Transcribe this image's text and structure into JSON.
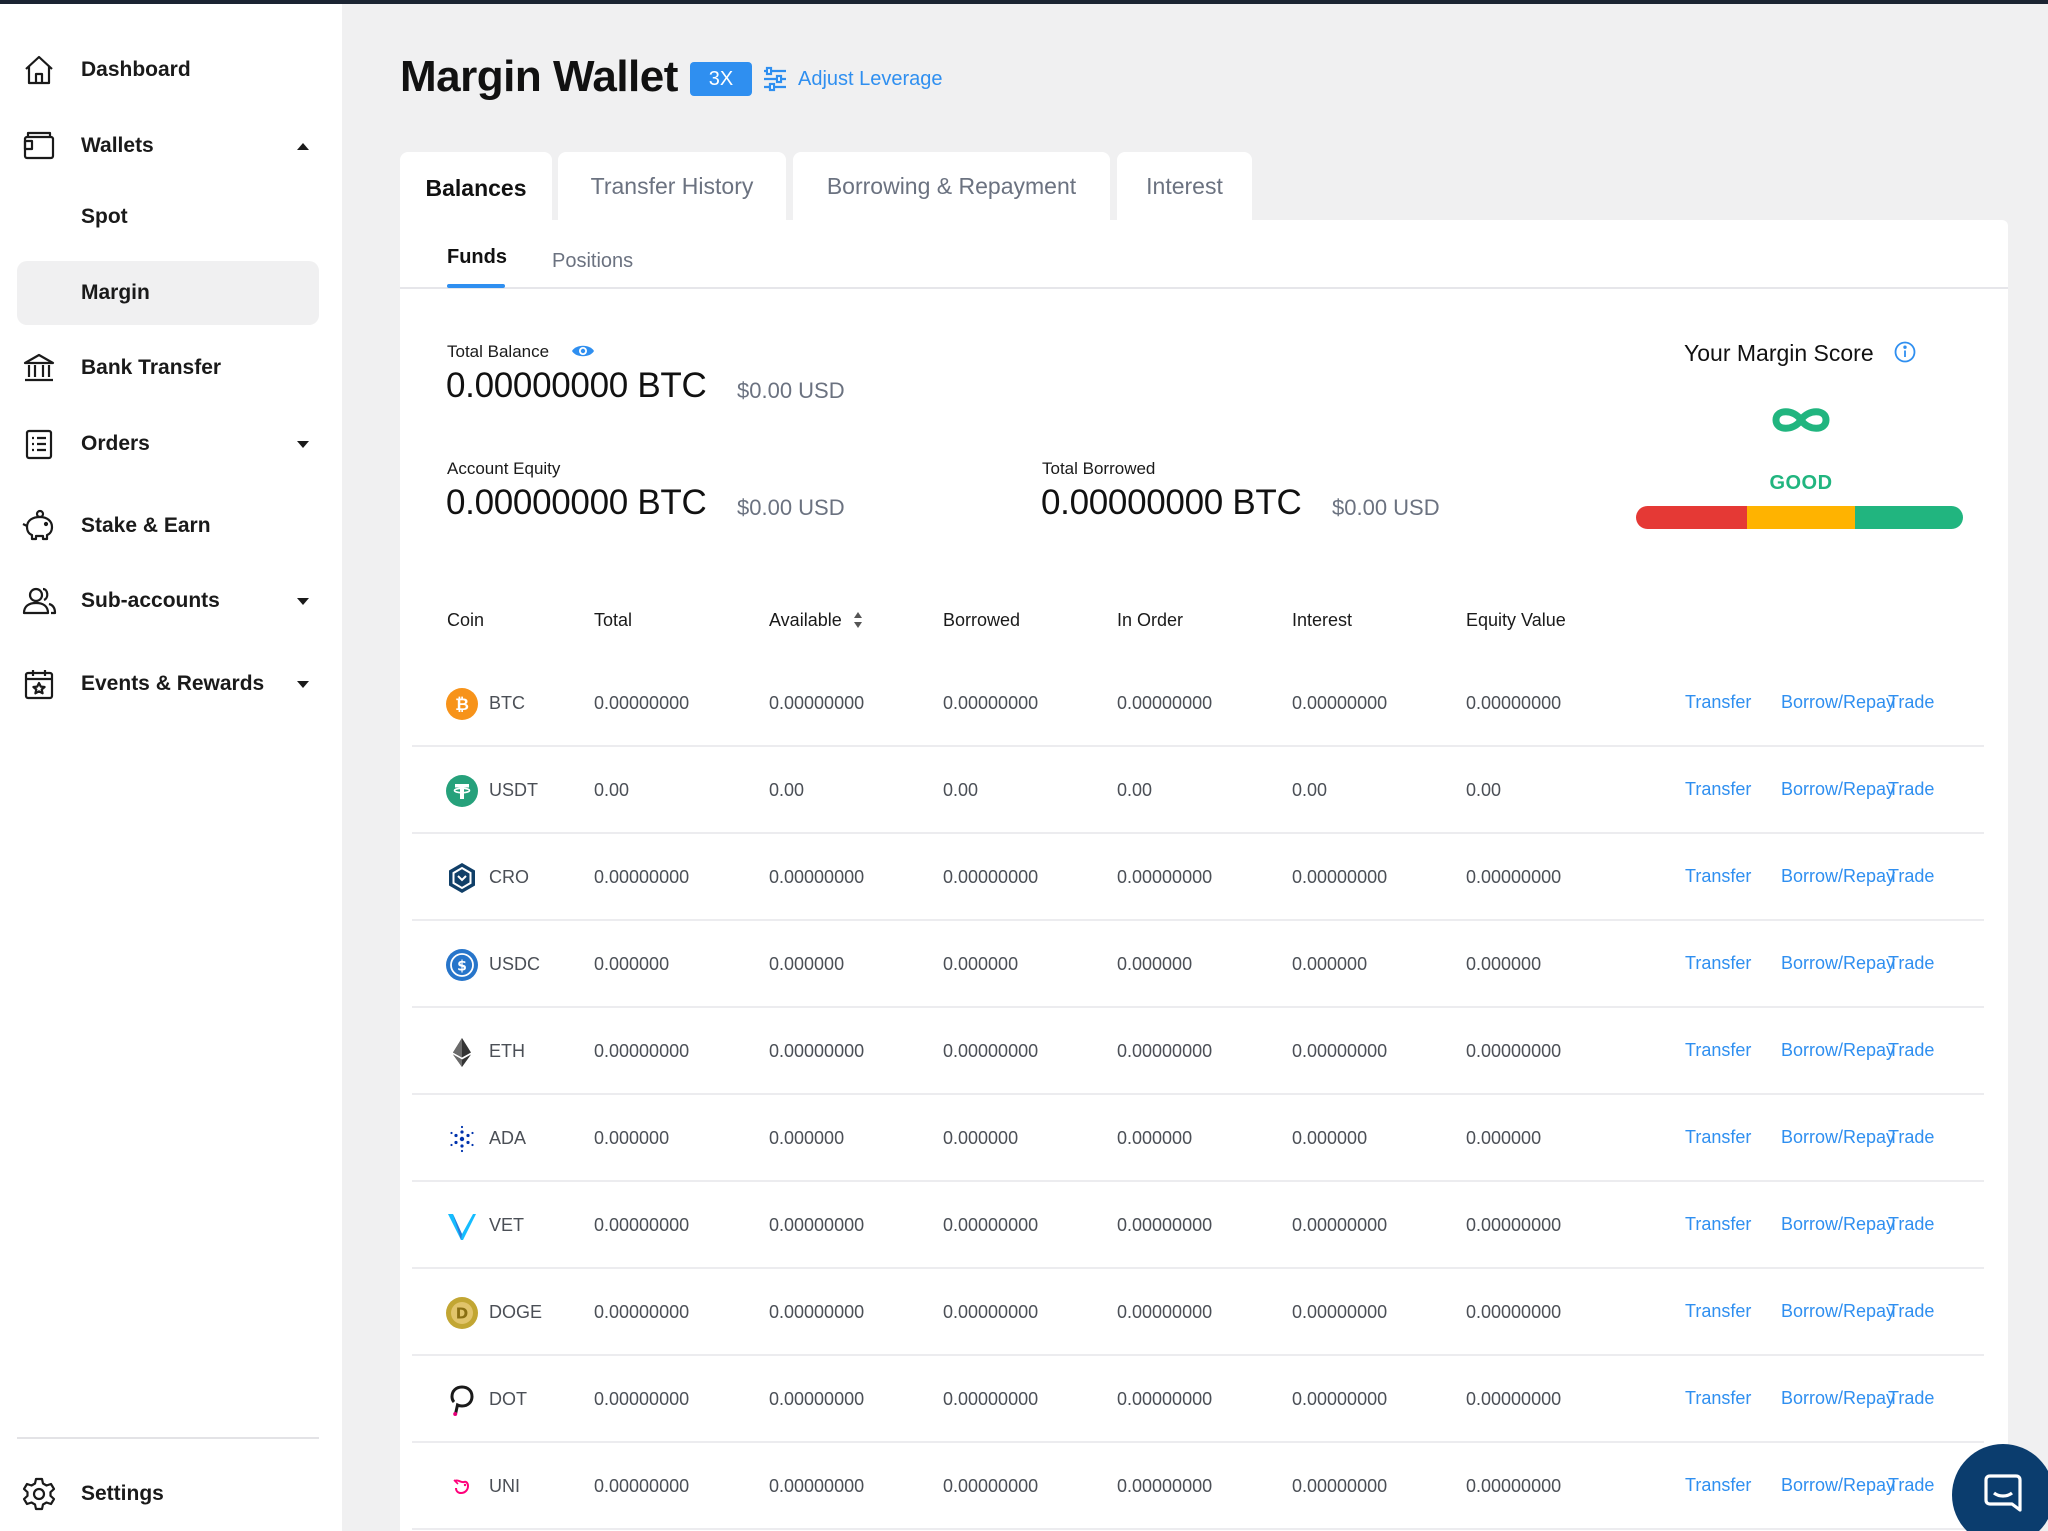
{
  "sidebar": {
    "dashboard": "Dashboard",
    "wallets": "Wallets",
    "spot": "Spot",
    "margin": "Margin",
    "bank_transfer": "Bank Transfer",
    "orders": "Orders",
    "stake_earn": "Stake & Earn",
    "sub_accounts": "Sub-accounts",
    "events_rewards": "Events & Rewards",
    "settings": "Settings"
  },
  "header": {
    "title": "Margin Wallet",
    "leverage": "3X",
    "adjust_leverage": "Adjust Leverage"
  },
  "tabs": [
    "Balances",
    "Transfer History",
    "Borrowing & Repayment",
    "Interest"
  ],
  "subtabs": [
    "Funds",
    "Positions"
  ],
  "summary": {
    "total_balance_label": "Total Balance",
    "total_balance_btc": "0.00000000 BTC",
    "total_balance_usd": "$0.00 USD",
    "account_equity_label": "Account Equity",
    "account_equity_btc": "0.00000000 BTC",
    "account_equity_usd": "$0.00 USD",
    "total_borrowed_label": "Total Borrowed",
    "total_borrowed_btc": "0.00000000 BTC",
    "total_borrowed_usd": "$0.00 USD"
  },
  "margin_score": {
    "title": "Your Margin Score",
    "status": "GOOD",
    "colors": [
      "#e53935",
      "#ffb300",
      "#21b57f"
    ]
  },
  "table": {
    "headers": [
      "Coin",
      "Total",
      "Available",
      "Borrowed",
      "In Order",
      "Interest",
      "Equity Value"
    ],
    "actions": [
      "Transfer",
      "Borrow/Repay",
      "Trade"
    ],
    "rows": [
      {
        "coin": "BTC",
        "icon": "btc-icon",
        "values": [
          "0.00000000",
          "0.00000000",
          "0.00000000",
          "0.00000000",
          "0.00000000",
          "0.00000000"
        ]
      },
      {
        "coin": "USDT",
        "icon": "usdt-icon",
        "values": [
          "0.00",
          "0.00",
          "0.00",
          "0.00",
          "0.00",
          "0.00"
        ]
      },
      {
        "coin": "CRO",
        "icon": "cro-icon",
        "values": [
          "0.00000000",
          "0.00000000",
          "0.00000000",
          "0.00000000",
          "0.00000000",
          "0.00000000"
        ]
      },
      {
        "coin": "USDC",
        "icon": "usdc-icon",
        "values": [
          "0.000000",
          "0.000000",
          "0.000000",
          "0.000000",
          "0.000000",
          "0.000000"
        ]
      },
      {
        "coin": "ETH",
        "icon": "eth-icon",
        "values": [
          "0.00000000",
          "0.00000000",
          "0.00000000",
          "0.00000000",
          "0.00000000",
          "0.00000000"
        ]
      },
      {
        "coin": "ADA",
        "icon": "ada-icon",
        "values": [
          "0.000000",
          "0.000000",
          "0.000000",
          "0.000000",
          "0.000000",
          "0.000000"
        ]
      },
      {
        "coin": "VET",
        "icon": "vet-icon",
        "values": [
          "0.00000000",
          "0.00000000",
          "0.00000000",
          "0.00000000",
          "0.00000000",
          "0.00000000"
        ]
      },
      {
        "coin": "DOGE",
        "icon": "doge-icon",
        "values": [
          "0.00000000",
          "0.00000000",
          "0.00000000",
          "0.00000000",
          "0.00000000",
          "0.00000000"
        ]
      },
      {
        "coin": "DOT",
        "icon": "dot-icon",
        "values": [
          "0.00000000",
          "0.00000000",
          "0.00000000",
          "0.00000000",
          "0.00000000",
          "0.00000000"
        ]
      },
      {
        "coin": "UNI",
        "icon": "uni-icon",
        "values": [
          "0.00000000",
          "0.00000000",
          "0.00000000",
          "0.00000000",
          "0.00000000",
          "0.00000000"
        ]
      }
    ]
  },
  "colors": {
    "accent": "#2f8ff0",
    "good": "#21b57f",
    "chat": "#0b3d6e"
  }
}
